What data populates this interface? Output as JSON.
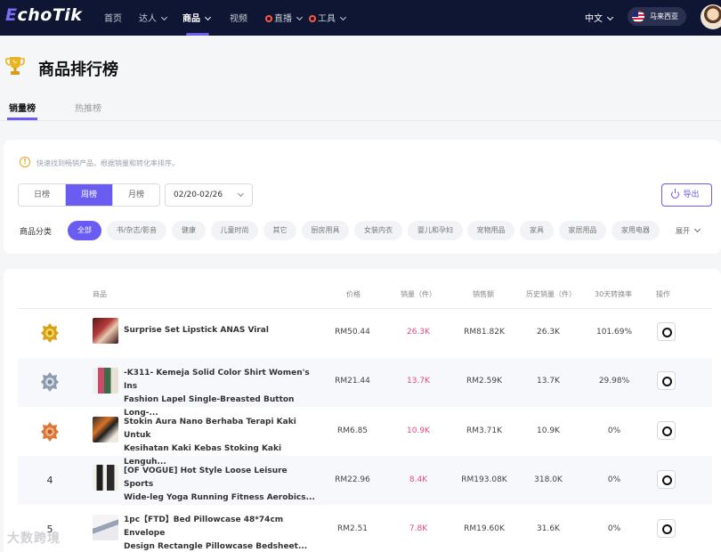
{
  "nav": {
    "logo_e": "E",
    "logo_rest": "choTik",
    "items": [
      {
        "label": "首页"
      },
      {
        "label": "达人"
      },
      {
        "label": "商品"
      },
      {
        "label": "视频"
      },
      {
        "label": "直播"
      },
      {
        "label": "工具"
      }
    ],
    "language": "中文",
    "region": "马来西亚"
  },
  "page": {
    "title": "商品排行榜",
    "tabs": [
      "销量榜",
      "热推榜"
    ]
  },
  "filters": {
    "tip": "快速找到畅销产品，根据销量和转化率排序。",
    "periods": [
      "日榜",
      "周榜",
      "月榜"
    ],
    "date_range": "02/20-02/26",
    "export_label": "导出",
    "category_label": "商品分类",
    "categories": [
      "全部",
      "书/杂志/影音",
      "健康",
      "儿童时尚",
      "其它",
      "厨房用具",
      "女装内衣",
      "婴儿和孕妇",
      "宠物用品",
      "家具",
      "家居用品",
      "家用电器"
    ],
    "expand_label": "展开"
  },
  "table": {
    "headers": [
      "商品",
      "价格",
      "销量（件）",
      "销售额",
      "历史销量（件）",
      "30天转换率",
      "操作"
    ],
    "rows": [
      {
        "rank": "1",
        "name": "Surprise Set Lipstick ANAS Viral",
        "price": "RM50.44",
        "sales": "26.3K",
        "revenue": "RM81.82K",
        "history": "26.3K",
        "conversion": "101.69%"
      },
      {
        "rank": "2",
        "name": "-K311- Kemeja Solid Color Shirt Women's Ins\nFashion Lapel Single-Breasted Button Long-...",
        "price": "RM21.44",
        "sales": "13.7K",
        "revenue": "RM2.59K",
        "history": "13.7K",
        "conversion": "29.98%"
      },
      {
        "rank": "3",
        "name": "Stokin Aura Nano Berhaba Terapi Kaki Untuk\nKesihatan Kaki Kebas Stoking Kaki Lenguh...",
        "price": "RM6.85",
        "sales": "10.9K",
        "revenue": "RM3.71K",
        "history": "10.9K",
        "conversion": "0%"
      },
      {
        "rank": "4",
        "name": "[OF VOGUE] Hot Style Loose Leisure Sports\nWide-leg Yoga Running Fitness Aerobics...",
        "price": "RM22.96",
        "sales": "8.4K",
        "revenue": "RM193.08K",
        "history": "318.0K",
        "conversion": "0%"
      },
      {
        "rank": "5",
        "name": "1pc【FTD】Bed Pillowcase 48*74cm Envelope\nDesign Rectangle Pillowcase Bedsheet...",
        "price": "RM2.51",
        "sales": "7.8K",
        "revenue": "RM19.60K",
        "history": "31.6K",
        "conversion": "0%"
      }
    ]
  },
  "watermark": "大数跨境",
  "colors": {
    "accent": "#6a5cf0",
    "nav_bg": "#0e1633",
    "sales_pink": "#e6497f",
    "gold": "#d8a21c",
    "silver": "#8e9ab0",
    "bronze": "#d9783a"
  }
}
